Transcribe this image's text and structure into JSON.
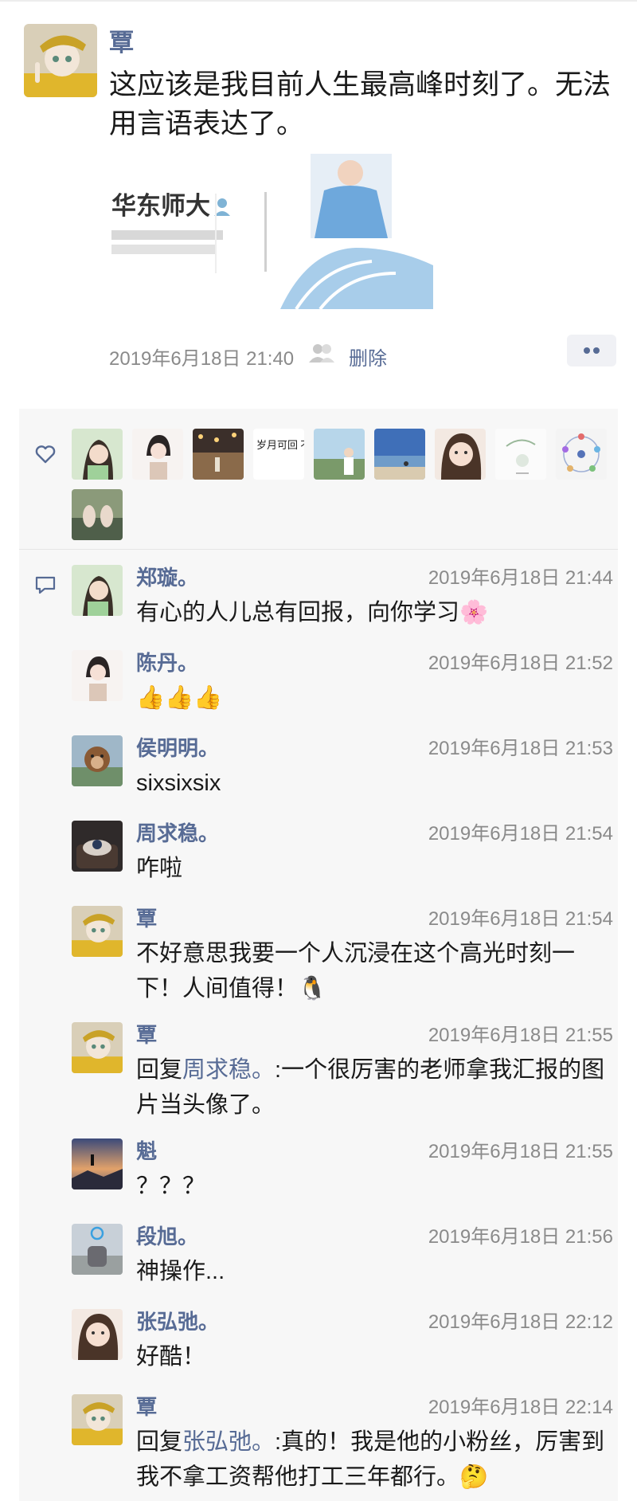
{
  "post": {
    "author": "覃",
    "text": "这应该是我目前人生最高峰时刻了。无法用言语表达了。",
    "image": {
      "school_text": "华东师大"
    },
    "timestamp": "2019年6月18日 21:40",
    "delete_label": "删除"
  },
  "comments": [
    {
      "name": "郑璇。",
      "time": "2019年6月18日 21:44",
      "text": "有心的人儿总有回报，向你学习🌸"
    },
    {
      "name": "陈丹。",
      "time": "2019年6月18日 21:52",
      "text": "👍👍👍"
    },
    {
      "name": "侯明明。",
      "time": "2019年6月18日 21:53",
      "text": "sixsixsix"
    },
    {
      "name": "周求稳。",
      "time": "2019年6月18日 21:54",
      "text": "咋啦"
    },
    {
      "name": "覃",
      "time": "2019年6月18日 21:54",
      "text": "不好意思我要一个人沉浸在这个高光时刻一下！人间值得！🐧"
    },
    {
      "name": "覃",
      "time": "2019年6月18日 21:55",
      "reply_prefix": "回复",
      "reply_to": "周求稳。",
      "text": ":一个很厉害的老师拿我汇报的图片当头像了。"
    },
    {
      "name": "魁",
      "time": "2019年6月18日 21:55",
      "text": "？？？"
    },
    {
      "name": "段旭。",
      "time": "2019年6月18日 21:56",
      "text": "神操作..."
    },
    {
      "name": "张弘弛。",
      "time": "2019年6月18日 22:12",
      "text": "好酷！"
    },
    {
      "name": "覃",
      "time": "2019年6月18日 22:14",
      "reply_prefix": "回复",
      "reply_to": "张弘弛。",
      "text": ":真的！我是他的小粉丝，厉害到我不拿工资帮他打工三年都行。🤔"
    }
  ],
  "likes_avatar_art": {
    "calligraphy": "岁月可回 不负韶华"
  },
  "colors": {
    "link": "#576b95",
    "panel": "#f7f7f7",
    "meta": "#8a8a8a"
  },
  "icons": {
    "likes": "heart-icon",
    "comments": "comment-icon",
    "visibility": "people-icon",
    "more": "more-dots-icon"
  }
}
